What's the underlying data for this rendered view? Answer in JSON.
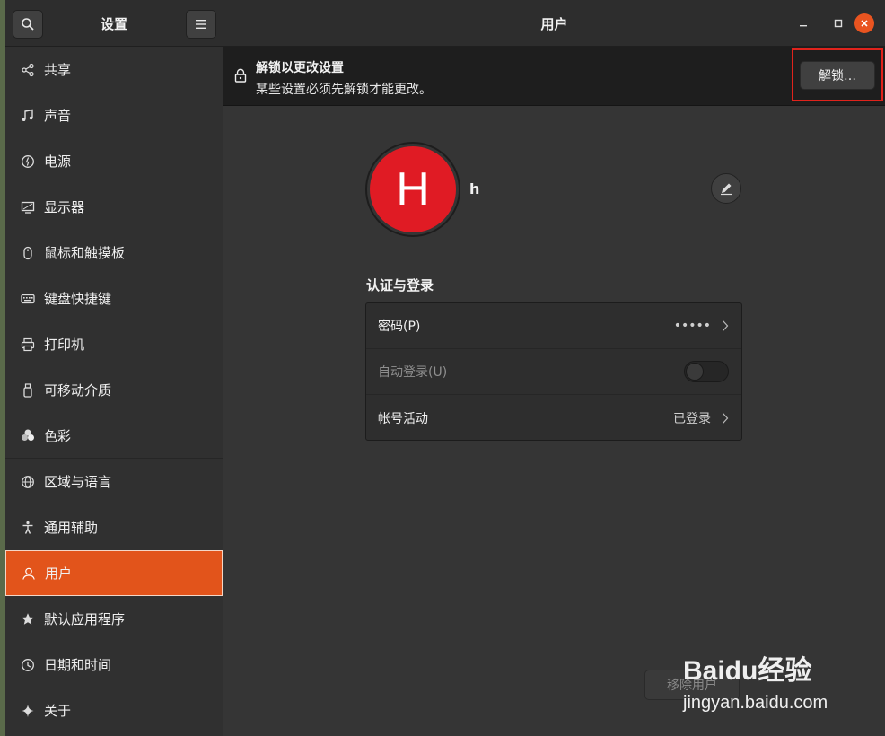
{
  "header": {
    "sidebar_title": "设置",
    "main_title": "用户",
    "search_icon": "search-icon",
    "menu_icon": "hamburger-menu-icon"
  },
  "sidebar": {
    "items": [
      {
        "label": "共享",
        "icon": "share-icon"
      },
      {
        "label": "声音",
        "icon": "music-note-icon"
      },
      {
        "label": "电源",
        "icon": "power-icon"
      },
      {
        "label": "显示器",
        "icon": "display-icon"
      },
      {
        "label": "鼠标和触摸板",
        "icon": "mouse-icon"
      },
      {
        "label": "键盘快捷键",
        "icon": "keyboard-icon"
      },
      {
        "label": "打印机",
        "icon": "printer-icon"
      },
      {
        "label": "可移动介质",
        "icon": "usb-drive-icon"
      },
      {
        "label": "色彩",
        "icon": "color-icon"
      },
      {
        "label": "区域与语言",
        "icon": "globe-icon"
      },
      {
        "label": "通用辅助",
        "icon": "accessibility-icon"
      },
      {
        "label": "用户",
        "icon": "user-icon",
        "active": true
      },
      {
        "label": "默认应用程序",
        "icon": "star-icon"
      },
      {
        "label": "日期和时间",
        "icon": "clock-icon"
      },
      {
        "label": "关于",
        "icon": "sparkle-icon"
      }
    ]
  },
  "infobar": {
    "title": "解锁以更改设置",
    "subtitle": "某些设置必须先解锁才能更改。",
    "unlock_label": "解锁…"
  },
  "user": {
    "avatar_initial": "H",
    "name": "h"
  },
  "auth": {
    "section_title": "认证与登录",
    "rows": [
      {
        "label": "密码(P)",
        "value": "•••••"
      },
      {
        "label": "自动登录(U)",
        "value": ""
      },
      {
        "label": "帐号活动",
        "value": "已登录"
      }
    ]
  },
  "remove_user_label": "移除用户",
  "watermark": {
    "brand": "Baidu经验",
    "url": "jingyan.baidu.com"
  },
  "colors": {
    "accent": "#e2541b",
    "avatar": "#e01b24",
    "close_button": "#e95420",
    "highlight_box": "#e0231c"
  }
}
